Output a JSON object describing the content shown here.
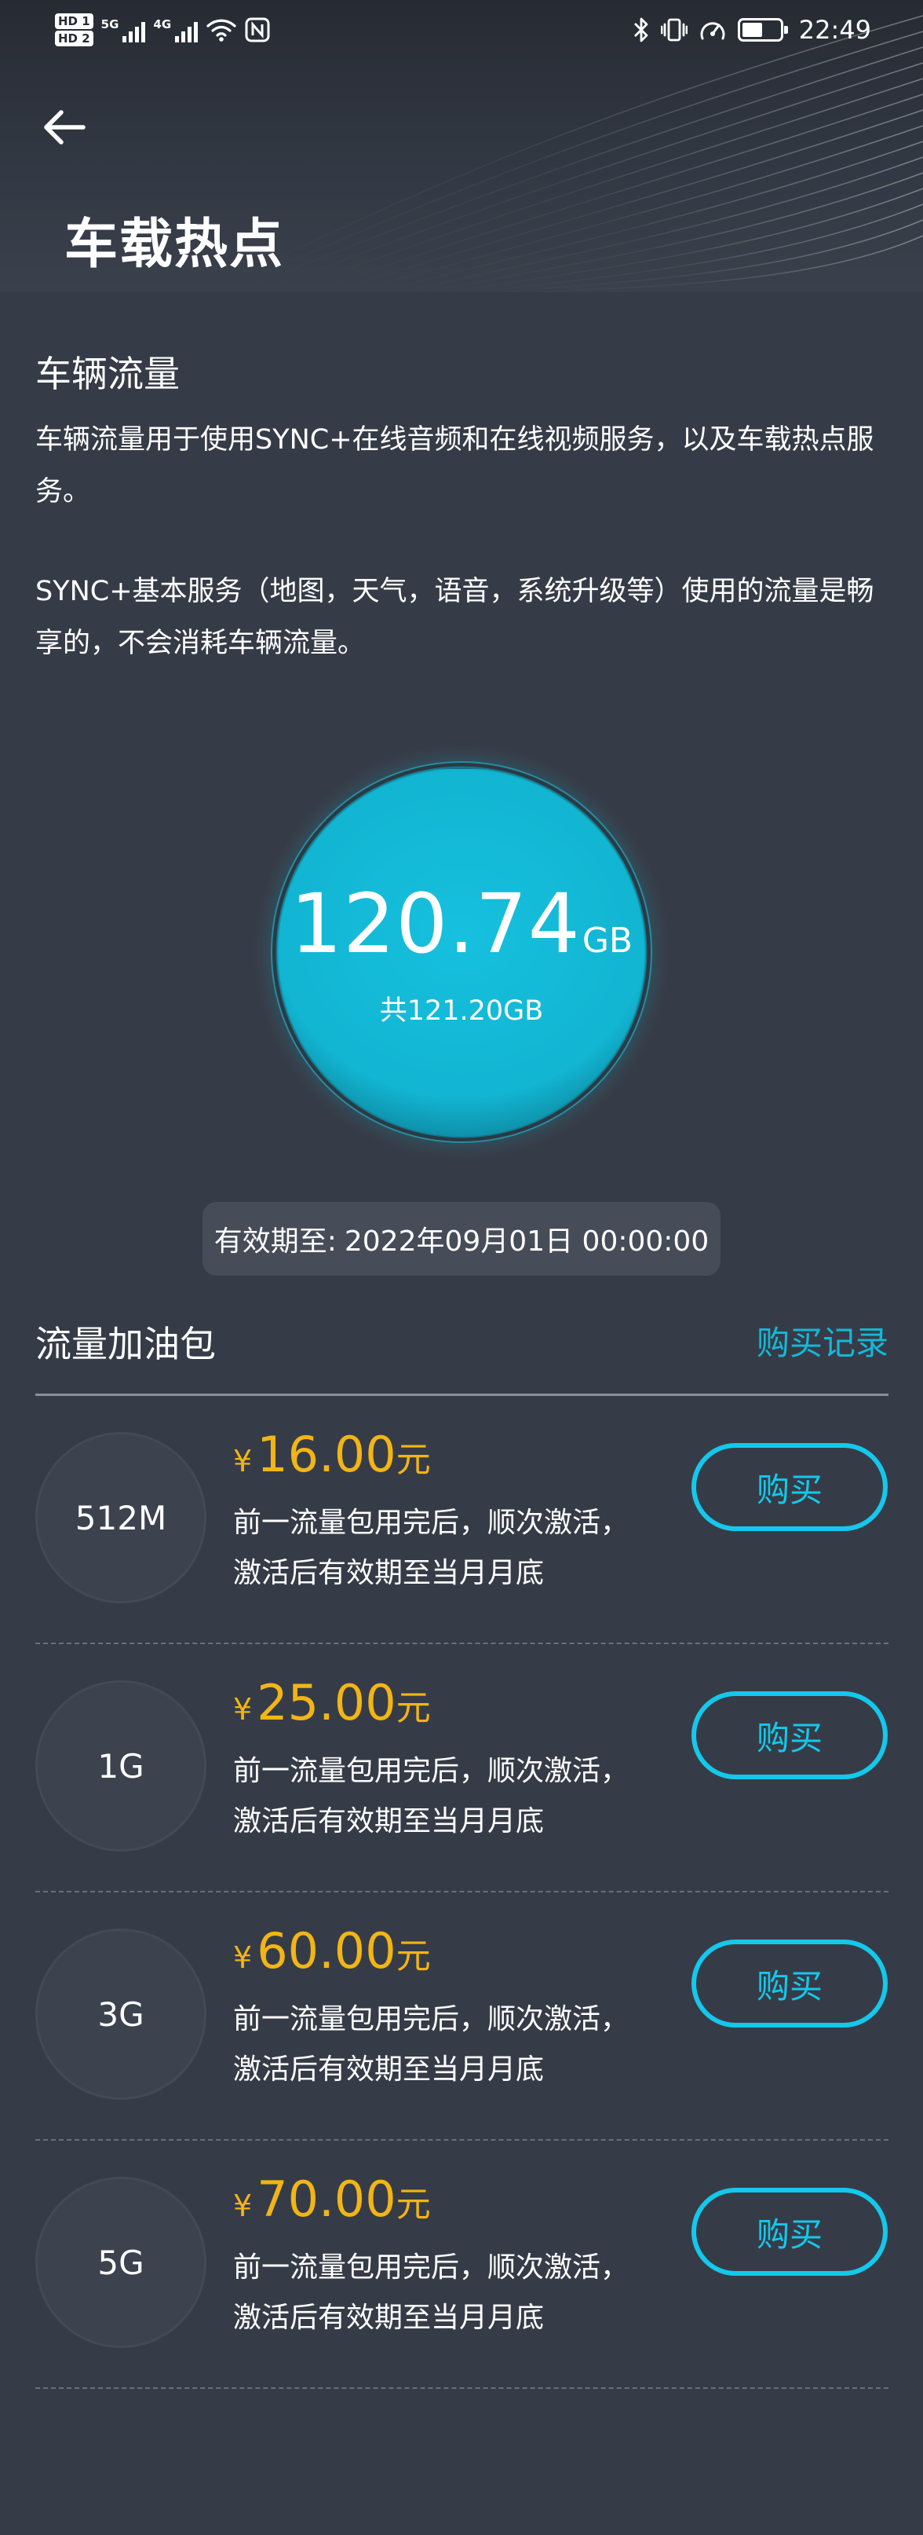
{
  "status_bar": {
    "hd1": "HD 1",
    "hd2": "HD 2",
    "net1": "5G",
    "net2": "4G",
    "time": "22:49",
    "battery_level": 0.55,
    "icons": [
      "bluetooth-icon",
      "vibrate-icon",
      "speed-icon",
      "battery-icon",
      "wifi-icon",
      "nfc-icon"
    ]
  },
  "header": {
    "title": "车载热点"
  },
  "intro": {
    "title": "车辆流量",
    "desc1": "车辆流量用于使用SYNC+在线音频和在线视频服务，以及车载热点服务。",
    "desc2": "SYNC+基本服务（地图，天气，语音，系统升级等）使用的流量是畅享的，不会消耗车辆流量。"
  },
  "usage": {
    "remaining": "120.74",
    "unit": "GB",
    "total_label": "共121.20GB",
    "remaining_fraction": 0.9962
  },
  "validity": {
    "label": "有效期至:",
    "value": "2022年09月01日 00:00:00"
  },
  "packages": {
    "title": "流量加油包",
    "history_label": "购买记录",
    "currency": "¥",
    "yuan": "元",
    "buy_label": "购买",
    "items": [
      {
        "size": "512M",
        "price": "16.00",
        "note1": "前一流量包用完后，顺次激活，",
        "note2": "激活后有效期至当月月底"
      },
      {
        "size": "1G",
        "price": "25.00",
        "note1": "前一流量包用完后，顺次激活，",
        "note2": "激活后有效期至当月月底"
      },
      {
        "size": "3G",
        "price": "60.00",
        "note1": "前一流量包用完后，顺次激活，",
        "note2": "激活后有效期至当月月底"
      },
      {
        "size": "5G",
        "price": "70.00",
        "note1": "前一流量包用完后，顺次激活，",
        "note2": "激活后有效期至当月月底"
      }
    ]
  },
  "colors": {
    "background": "#363c47",
    "accent": "#14c8ec",
    "price": "#f2b514",
    "gauge_fill": "#13b7d4"
  }
}
